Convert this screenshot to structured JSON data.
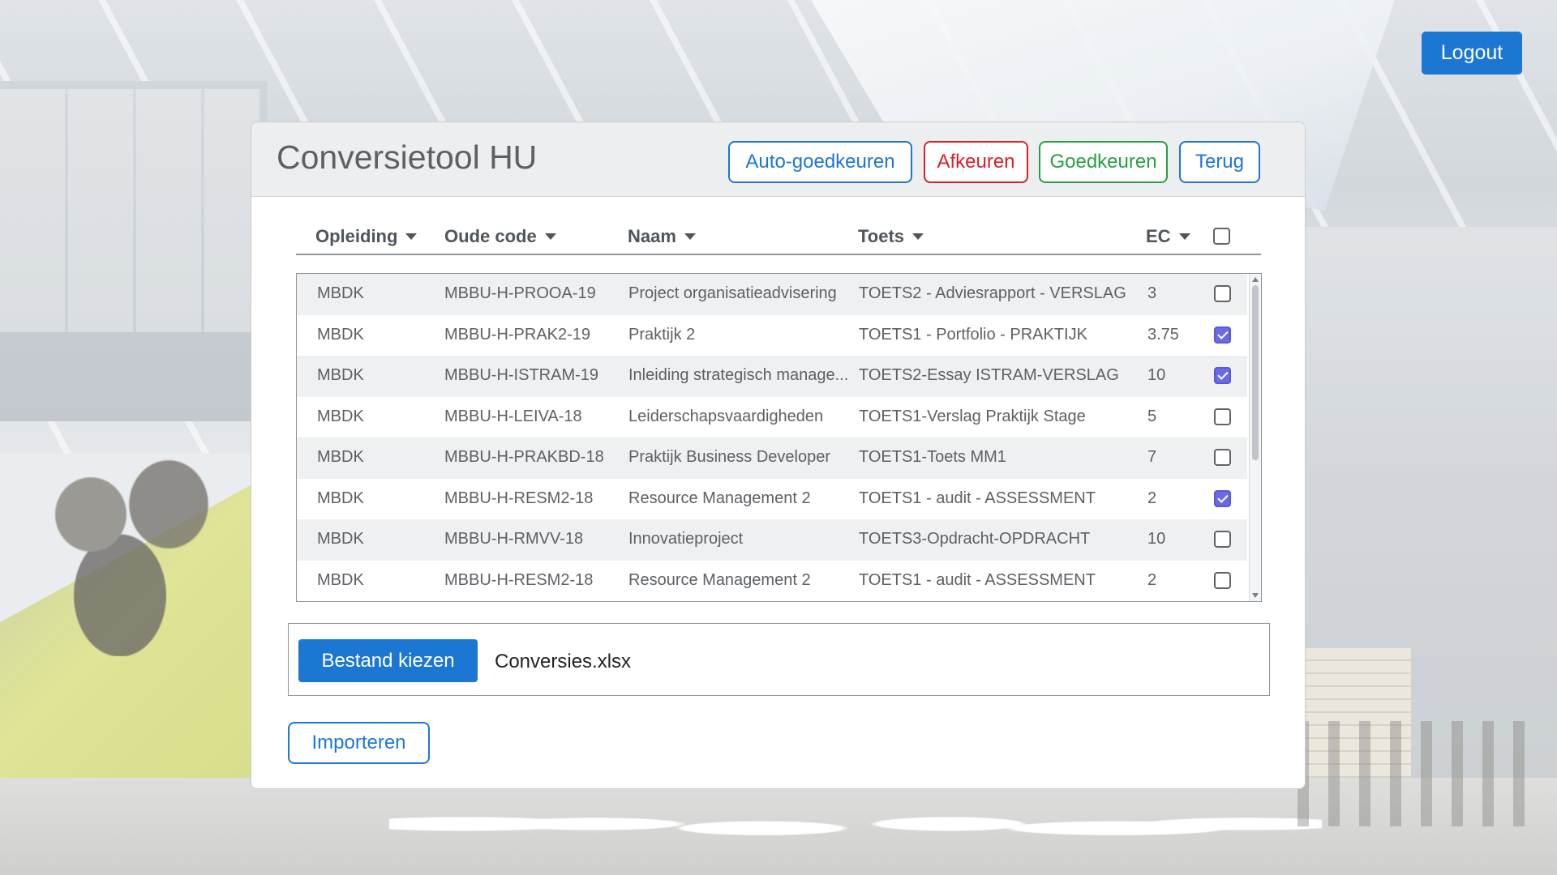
{
  "header": {
    "logout_label": "Logout"
  },
  "panel": {
    "title": "Conversietool HU",
    "buttons": {
      "auto_approve": "Auto-goedkeuren",
      "reject": "Afkeuren",
      "approve": "Goedkeuren",
      "back": "Terug"
    }
  },
  "table": {
    "columns": {
      "opleiding": "Opleiding",
      "oude_code": "Oude code",
      "naam": "Naam",
      "toets": "Toets",
      "ec": "EC"
    },
    "select_all_checked": false,
    "rows": [
      {
        "opleiding": "MBDK",
        "oude_code": "MBBU-H-PROOA-19",
        "naam": "Project organisatieadvisering",
        "toets": "TOETS2 - Adviesrapport - VERSLAG",
        "ec": "3",
        "checked": false
      },
      {
        "opleiding": "MBDK",
        "oude_code": "MBBU-H-PRAK2-19",
        "naam": "Praktijk 2",
        "toets": "TOETS1 - Portfolio - PRAKTIJK",
        "ec": "3.75",
        "checked": true
      },
      {
        "opleiding": "MBDK",
        "oude_code": "MBBU-H-ISTRAM-19",
        "naam": "Inleiding strategisch manage...",
        "toets": "TOETS2-Essay ISTRAM-VERSLAG",
        "ec": "10",
        "checked": true
      },
      {
        "opleiding": "MBDK",
        "oude_code": "MBBU-H-LEIVA-18",
        "naam": "Leiderschapsvaardigheden",
        "toets": "TOETS1-Verslag Praktijk Stage",
        "ec": "5",
        "checked": false
      },
      {
        "opleiding": "MBDK",
        "oude_code": "MBBU-H-PRAKBD-18",
        "naam": "Praktijk Business Developer",
        "toets": "TOETS1-Toets MM1",
        "ec": "7",
        "checked": false
      },
      {
        "opleiding": "MBDK",
        "oude_code": "MBBU-H-RESM2-18",
        "naam": "Resource Management 2",
        "toets": "TOETS1 - audit - ASSESSMENT",
        "ec": "2",
        "checked": true
      },
      {
        "opleiding": "MBDK",
        "oude_code": "MBBU-H-RMVV-18",
        "naam": "Innovatieproject",
        "toets": "TOETS3-Opdracht-OPDRACHT",
        "ec": "10",
        "checked": false
      },
      {
        "opleiding": "MBDK",
        "oude_code": "MBBU-H-RESM2-18",
        "naam": "Resource Management 2",
        "toets": "TOETS1 - audit - ASSESSMENT",
        "ec": "2",
        "checked": false
      }
    ]
  },
  "file": {
    "choose_label": "Bestand kiezen",
    "file_name": "Conversies.xlsx"
  },
  "import_label": "Importeren",
  "colors": {
    "primary": "#1c77d2",
    "danger": "#d91f2a",
    "success": "#26a042",
    "checkbox_checked": "#6b6ae6"
  }
}
